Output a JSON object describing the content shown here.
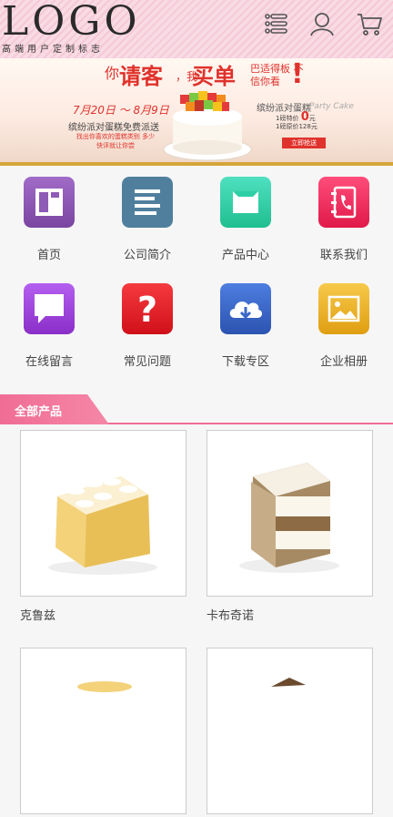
{
  "header": {
    "logo": "LOGO",
    "logo_subtitle": "高端用户定制标志",
    "icons": [
      "menu-list-icon",
      "user-icon",
      "cart-icon"
    ]
  },
  "banner": {
    "t1": "你",
    "t2": "请客",
    "t3": "，我",
    "t4": "买单",
    "t5": "巴适得板 不信你看",
    "t6": "!",
    "date": "7月20日 ～ 8月9日",
    "info1": "缤纷派对蛋糕免费派送",
    "info2": "找出你喜欢的蛋糕类别 多少快评就让你尝",
    "right_title": "缤纷派对蛋糕",
    "right_script": "Party Cake",
    "price_line1": "1磅特价",
    "price_value": "0",
    "price_unit": "元",
    "price_line2": "1磅原价128元",
    "button": "立即抢送",
    "accent": "#e0322c"
  },
  "nav": [
    {
      "label": "首页",
      "icon": "home-icon",
      "color": "#8e5bb5"
    },
    {
      "label": "公司简介",
      "icon": "document-lines-icon",
      "color": "#4f7f9d"
    },
    {
      "label": "产品中心",
      "icon": "box-icon",
      "color": "#2fcfa5"
    },
    {
      "label": "联系我们",
      "icon": "contact-book-icon",
      "color": "#ee2c5a"
    },
    {
      "label": "在线留言",
      "icon": "message-bubble-icon",
      "color": "#9b3fd8"
    },
    {
      "label": "常见问题",
      "icon": "question-icon",
      "color": "#e5202a"
    },
    {
      "label": "下载专区",
      "icon": "cloud-download-icon",
      "color": "#3b67c9"
    },
    {
      "label": "企业相册",
      "icon": "photo-icon",
      "color": "#eab326"
    }
  ],
  "section": {
    "title": "全部产品",
    "accent": "#f06d95"
  },
  "products": [
    {
      "name": "克鲁兹"
    },
    {
      "name": "卡布奇诺"
    },
    {
      "name": ""
    },
    {
      "name": ""
    }
  ]
}
